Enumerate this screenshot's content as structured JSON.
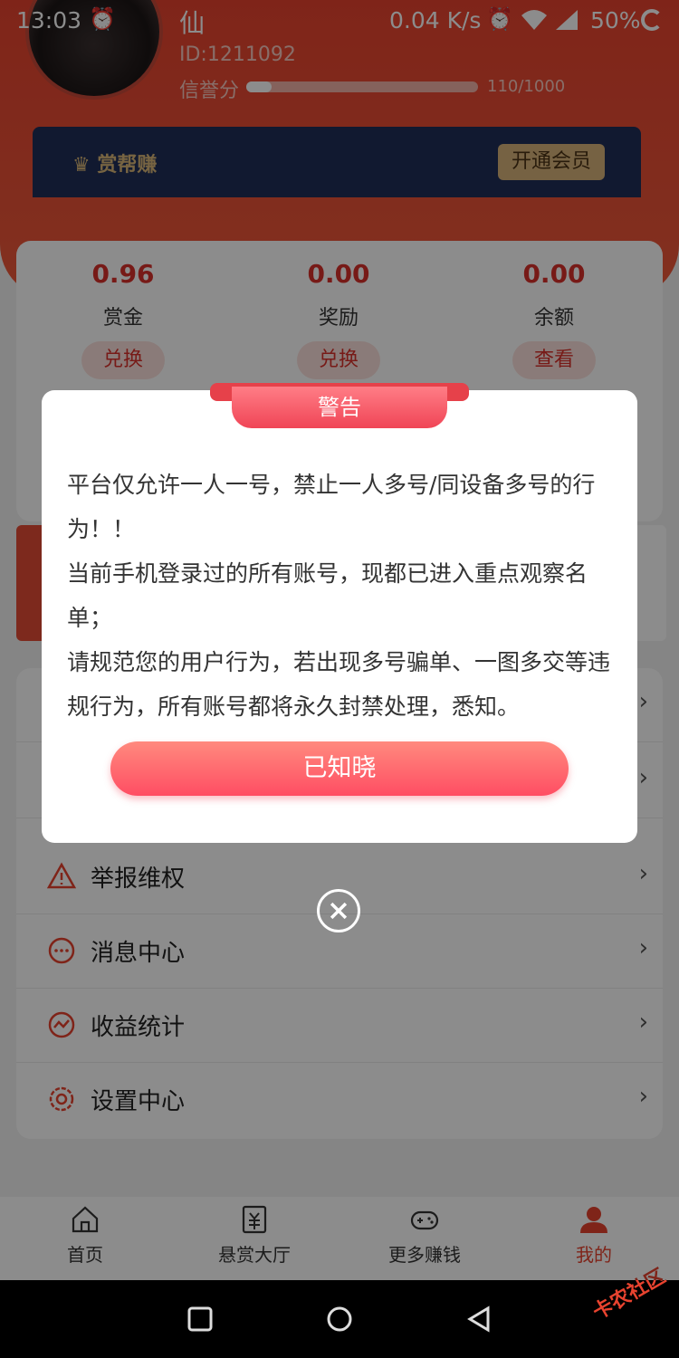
{
  "status_bar": {
    "time": "13:03",
    "speed": "0.04 K/s",
    "battery": "50%"
  },
  "profile": {
    "name": "仙",
    "id": "ID:1211092",
    "credit_label": "信誉分",
    "credit_value": "110/1000",
    "credit_progress": 0.11
  },
  "vip": {
    "brand": "赏帮赚",
    "button": "开通会员"
  },
  "wallet": [
    {
      "amount": "0.96",
      "label": "赏金",
      "button": "兑换"
    },
    {
      "amount": "0.00",
      "label": "奖励",
      "button": "兑换"
    },
    {
      "amount": "0.00",
      "label": "余额",
      "button": "查看"
    }
  ],
  "menu": [
    {
      "label": "举报维权",
      "icon": "warning-icon"
    },
    {
      "label": "消息中心",
      "icon": "message-icon"
    },
    {
      "label": "收益统计",
      "icon": "chart-icon"
    },
    {
      "label": "设置中心",
      "icon": "settings-icon"
    }
  ],
  "tabbar": [
    {
      "label": "首页",
      "icon": "home-icon"
    },
    {
      "label": "悬赏大厅",
      "icon": "reward-icon"
    },
    {
      "label": "更多赚钱",
      "icon": "gamepad-icon"
    },
    {
      "label": "我的",
      "icon": "user-icon"
    }
  ],
  "modal": {
    "title": "警告",
    "lines": [
      "平台仅允许一人一号，禁止一人多号/同设备多号的行为！！",
      "当前手机登录过的所有账号，现都已进入重点观察名单；",
      "请规范您的用户行为，若出现多号骗单、一图多交等违规行为，所有账号都将永久封禁处理，悉知。"
    ],
    "button": "已知晓"
  },
  "watermark": "卡农社区",
  "colors": {
    "brand_red": "#e8432f",
    "alert_pink": "#ff4d63",
    "vip_navy": "#1f2f58",
    "vip_gold": "#d8b27a"
  }
}
